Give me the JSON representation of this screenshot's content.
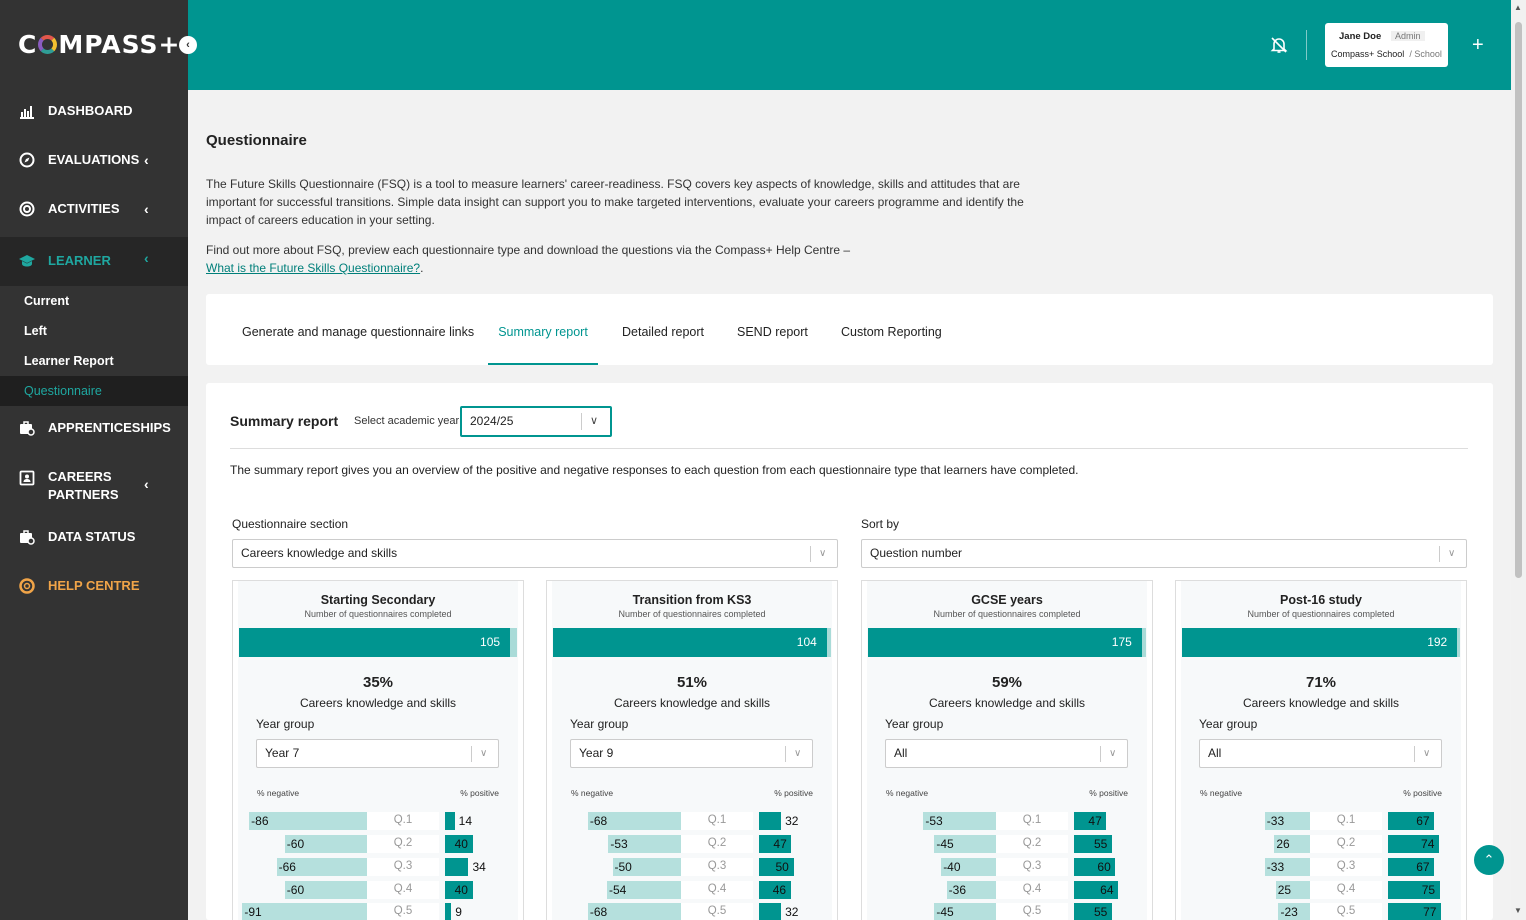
{
  "sidebar": {
    "logo": "COMPASS+",
    "collapse_glyph": "‹",
    "nav": [
      {
        "label": "DASHBOARD",
        "icon": "dashboard-icon",
        "chevron": ""
      },
      {
        "label": "EVALUATIONS",
        "icon": "compass-icon",
        "chevron": "‹"
      },
      {
        "label": "ACTIVITIES",
        "icon": "activities-icon",
        "chevron": "‹"
      },
      {
        "label": "LEARNER",
        "icon": "graduation-cap-icon",
        "chevron": "‹"
      }
    ],
    "sub_items": [
      "Current",
      "Left",
      "Learner Report",
      "Questionnaire"
    ],
    "nav2": [
      {
        "label": "APPRENTICESHIPS",
        "icon": "briefcase-search-icon"
      },
      {
        "label": "CAREERS",
        "label2": "PARTNERS",
        "icon": "contact-card-icon",
        "chevron": "‹"
      },
      {
        "label": "DATA STATUS",
        "icon": "briefcase-search-icon"
      },
      {
        "label": "HELP CENTRE",
        "icon": "lifebuoy-icon"
      }
    ]
  },
  "header": {
    "user_name": "Jane Doe",
    "user_role": "Admin",
    "school": "Compass+ School",
    "school_type": "/ School",
    "plus": "+",
    "accent": "#009590"
  },
  "main": {
    "title": "Questionnaire",
    "intro": "The Future Skills Questionnaire (FSQ) is a tool to measure learners' career-readiness. FSQ covers key aspects of knowledge, skills and attitudes that are important for successful transitions. Simple data insight can support you to make targeted interventions, evaluate your careers programme and identify the impact of careers education in your setting.",
    "intro2": "Find out more about FSQ, preview each questionnaire type and download the questions via the Compass+ Help Centre –",
    "help_link": "What is the Future Skills Questionnaire?",
    "help_link_suffix": ".",
    "tabs": [
      "Generate and manage questionnaire links",
      "Summary report",
      "Detailed report",
      "SEND report",
      "Custom Reporting"
    ],
    "report": {
      "title": "Summary report",
      "year_label": "Select academic year",
      "year_value": "2024/25",
      "description": "The summary report gives you an overview of the positive and negative responses to each question from each questionnaire type that learners have completed.",
      "section_label": "Questionnaire section",
      "section_value": "Careers knowledge and skills",
      "sort_label": "Sort by",
      "sort_value": "Question number"
    },
    "panel_common": {
      "completed_label": "Number of questionnaires completed",
      "year_group_label": "Year group",
      "neg_label": "% negative",
      "pos_label": "% positive"
    },
    "panels": [
      {
        "title": "Starting Secondary",
        "count": "105",
        "count_frac": 0.975,
        "percent": "35%",
        "section": "Careers knowledge and skills",
        "year_group": "Year 7",
        "rows": [
          {
            "q": "Q.1",
            "neg": "-86",
            "pos": "14"
          },
          {
            "q": "Q.2",
            "neg": "-60",
            "pos": "40"
          },
          {
            "q": "Q.3",
            "neg": "-66",
            "pos": "34"
          },
          {
            "q": "Q.4",
            "neg": "-60",
            "pos": "40"
          },
          {
            "q": "Q.5",
            "neg": "-91",
            "pos": "9"
          }
        ]
      },
      {
        "title": "Transition from KS3",
        "count": "104",
        "count_frac": 0.985,
        "percent": "51%",
        "section": "Careers knowledge and skills",
        "year_group": "Year 9",
        "rows": [
          {
            "q": "Q.1",
            "neg": "-68",
            "pos": "32"
          },
          {
            "q": "Q.2",
            "neg": "-53",
            "pos": "47"
          },
          {
            "q": "Q.3",
            "neg": "-50",
            "pos": "50"
          },
          {
            "q": "Q.4",
            "neg": "-54",
            "pos": "46"
          },
          {
            "q": "Q.5",
            "neg": "-68",
            "pos": "32"
          }
        ]
      },
      {
        "title": "GCSE years",
        "count": "175",
        "count_frac": 0.985,
        "percent": "59%",
        "section": "Careers knowledge and skills",
        "year_group": "All",
        "rows": [
          {
            "q": "Q.1",
            "neg": "-53",
            "pos": "47"
          },
          {
            "q": "Q.2",
            "neg": "-45",
            "pos": "55"
          },
          {
            "q": "Q.3",
            "neg": "-40",
            "pos": "60"
          },
          {
            "q": "Q.4",
            "neg": "-36",
            "pos": "64"
          },
          {
            "q": "Q.5",
            "neg": "-45",
            "pos": "55"
          }
        ]
      },
      {
        "title": "Post-16 study",
        "count": "192",
        "count_frac": 0.99,
        "percent": "71%",
        "section": "Careers knowledge and skills",
        "year_group": "All",
        "rows": [
          {
            "q": "Q.1",
            "neg": "-33",
            "pos": "67"
          },
          {
            "q": "Q.2",
            "neg": "26",
            "pos": "74"
          },
          {
            "q": "Q.3",
            "neg": "-33",
            "pos": "67"
          },
          {
            "q": "Q.4",
            "neg": "25",
            "pos": "75"
          },
          {
            "q": "Q.5",
            "neg": "-23",
            "pos": "77"
          }
        ]
      }
    ]
  }
}
